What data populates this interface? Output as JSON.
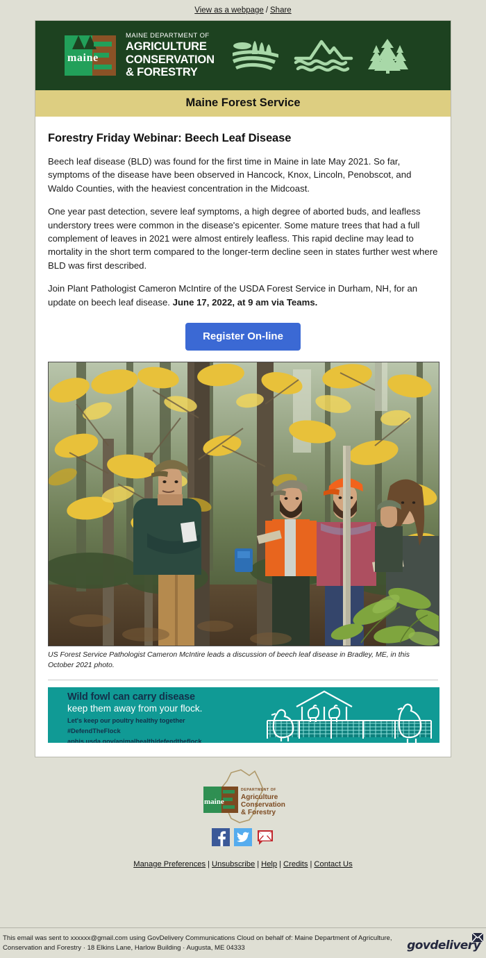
{
  "preheader": {
    "view_webpage": "View as a webpage",
    "separator": "/",
    "share": "Share"
  },
  "banner": {
    "logo_word": "maine",
    "dept_line": "MAINE DEPARTMENT OF",
    "line1": "AGRICULTURE",
    "line2": "CONSERVATION",
    "line3": "& FORESTRY",
    "icons": [
      "farm-field-icon",
      "mountain-river-icon",
      "pine-trees-icon"
    ],
    "bg_color": "#1d4220",
    "green": "#22a05a",
    "brown": "#8a5226"
  },
  "gold_bar": {
    "title": "Maine Forest Service",
    "bg_color": "#ddce81"
  },
  "article": {
    "title": "Forestry Friday Webinar: Beech Leaf Disease",
    "p1": "Beech leaf disease (BLD) was found for the first time in Maine in late May 2021. So far, symptoms of the disease have been observed in Hancock, Knox, Lincoln, Penobscot, and Waldo Counties, with the heaviest concentration in the Midcoast.",
    "p2": "One year past detection, severe leaf symptoms, a high degree of aborted buds, and leafless understory trees were common in the disease's epicenter. Some mature trees that had a full complement of leaves in 2021 were almost entirely leafless. This rapid decline may lead to mortality in the short term compared to the longer-term decline seen in states further west where BLD was first described.",
    "p3_normal": "Join Plant Pathologist Cameron McIntire of the USDA Forest Service in Durham, NH, for an update on beech leaf disease. ",
    "p3_bold": "June 17, 2022, at 9 am via Teams.",
    "register_button": "Register On-line",
    "register_button_color": "#3b69d4",
    "photo_alt": "forest-group-photo",
    "caption": "US Forest Service Pathologist Cameron McIntire leads a discussion of beech leaf disease in Bradley, ME, in this October 2021 photo."
  },
  "ad": {
    "headline": "Wild fowl can carry disease",
    "subhead": "keep them away from your flock.",
    "line3": "Let's keep our poultry healthy together",
    "hashtag": "#DefendTheFlock",
    "url": "aphis.usda.gov/animalhealth/defendtheflock",
    "bg_color": "#109a95"
  },
  "footer": {
    "logo_dept": "DEPARTMENT OF",
    "logo_l1": "Agriculture",
    "logo_l2": "Conservation",
    "logo_l3": "& Forestry",
    "logo_word": "maine",
    "social": [
      {
        "name": "facebook-icon",
        "color": "#3b5998"
      },
      {
        "name": "twitter-icon",
        "color": "#55acee"
      },
      {
        "name": "email-icon",
        "color": "#c1272d"
      }
    ],
    "links": [
      "Manage Preferences",
      "Unsubscribe",
      "Help",
      "Credits",
      "Contact Us"
    ],
    "link_separator": "|"
  },
  "bottom_bar": {
    "legal_line1": "This email was sent to xxxxxx@gmail.com using GovDelivery Communications Cloud on behalf of: Maine Department of Agriculture,",
    "legal_line2": "Conservation and Forestry · 18 Elkins Lane, Harlow Building · Augusta, ME 04333",
    "brand": "govdelivery"
  }
}
